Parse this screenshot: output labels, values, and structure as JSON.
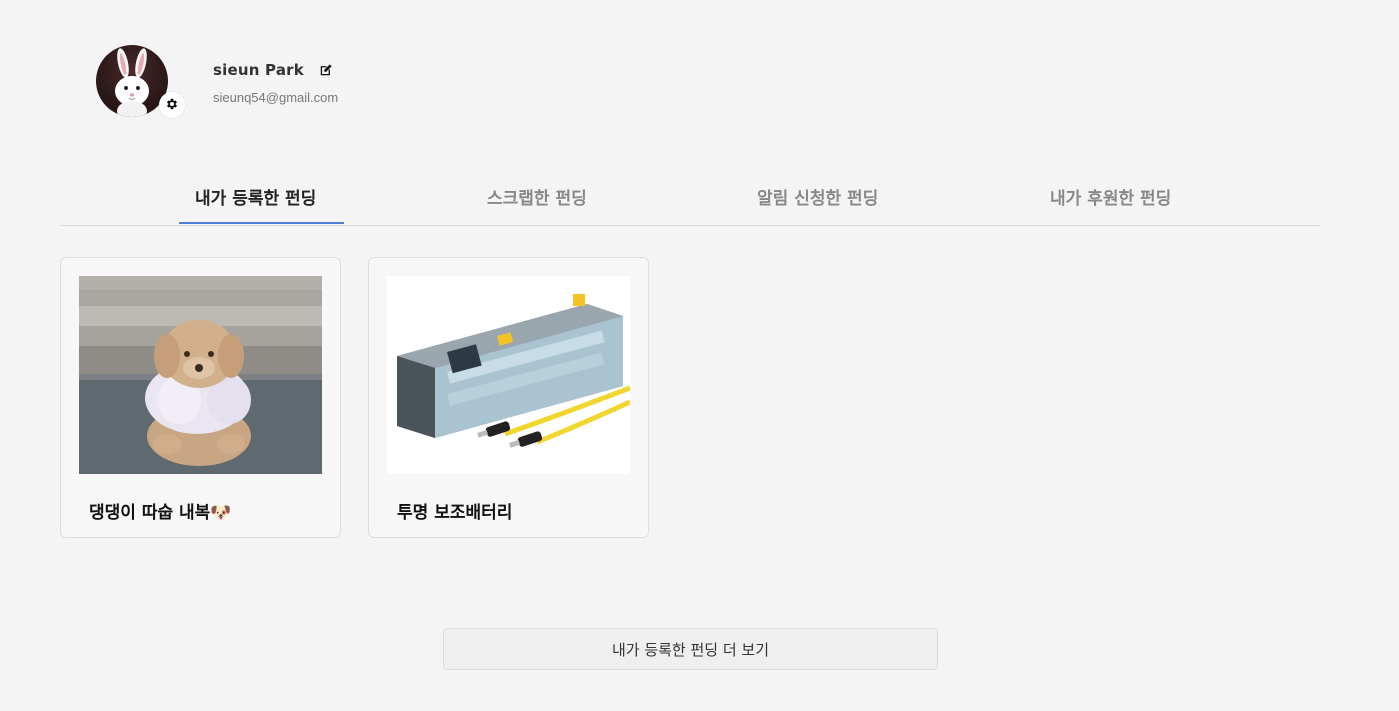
{
  "profile": {
    "name": "sieun Park",
    "email": "sieunq54@gmail.com"
  },
  "tabs": [
    {
      "label": "내가 등록한 펀딩",
      "active": true
    },
    {
      "label": "스크랩한 펀딩",
      "active": false
    },
    {
      "label": "알림 신청한 펀딩",
      "active": false
    },
    {
      "label": "내가 후원한 펀딩",
      "active": false
    }
  ],
  "cards": [
    {
      "title": "댕댕이 따숩 내복🐶"
    },
    {
      "title": "투명 보조배터리"
    }
  ],
  "more_button": {
    "label": "내가 등록한 펀딩 더 보기"
  },
  "colors": {
    "accent": "#4f7fd6",
    "background": "#f4f4f4"
  }
}
